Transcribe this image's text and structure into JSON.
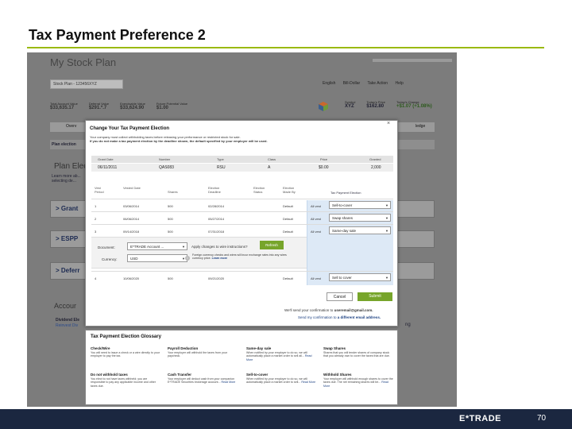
{
  "slide": {
    "title": "Tax Payment Preference 2",
    "footer_logo": "E*TRADE",
    "page_number": "70",
    "accent_color": "#9ab90c",
    "footer_color": "#1b2740"
  },
  "background": {
    "plan_title": "My Stock Plan",
    "plan_select": "Stock Plan - 123456XYZ",
    "top_links": [
      "English",
      "Bill-Dollar",
      "Take Action",
      "Help"
    ],
    "values": [
      {
        "label": "Total Account Value",
        "value": "$33,635.17"
      },
      {
        "label": "Deferral Value",
        "value": "$291.*.7"
      },
      {
        "label": "Exercisable Value",
        "value": "$33,624.90"
      },
      {
        "label": "Future Potential Value",
        "value": "$1.00"
      }
    ],
    "ticker": [
      {
        "label": "Symbol",
        "value": "XYZ"
      },
      {
        "label": "Today's Price",
        "value": "$162.80"
      },
      {
        "label": "Today's Change",
        "value": "+$1.07 (+1.08%)"
      }
    ],
    "tab_left": "Overv",
    "tab_right": "ledge",
    "plan_election_label": "Plan election",
    "section_heading": "Plan Elec",
    "section_desc": "Learn more ab... selecting de...",
    "sections": [
      "Grant",
      "ESPP",
      "Deferr"
    ],
    "account_heading": "Accour",
    "dividend_lines": [
      "Dividend Ele",
      "Reinvest Div"
    ],
    "side_note": "ng"
  },
  "modal": {
    "title": "Change Your Tax Payment Election",
    "desc": "Your company must collect withholding taxes before releasing your performance or restricted stock for sale.",
    "desc_bold": "If you do not make a tax payment election by the deadline shown, the default specified by your employer will be used.",
    "close": "×",
    "grant_headers": [
      "Grant Date",
      "Number",
      "Type",
      "Class",
      "Price",
      "Granted"
    ],
    "grant_row": [
      "06/11/2011",
      "QAS083",
      "RSU",
      "A",
      "$0.00",
      "2,000"
    ],
    "schedule_headers": [
      "Vest Period",
      "Vested Date",
      "Shares",
      "Election Deadline",
      "Election Status",
      "Election Made By",
      "Tax Payment Election"
    ],
    "rows": [
      {
        "period": "1",
        "vest_date": "03/06/2014",
        "shares": "500",
        "deadline": "02/28/2014",
        "made_by": "Default",
        "attrib": "All vest",
        "election": "Sell-to-cover"
      },
      {
        "period": "2",
        "vest_date": "06/06/2014",
        "shares": "500",
        "deadline": "05/27/2014",
        "made_by": "Default",
        "attrib": "All vest",
        "election": "Swap shares"
      },
      {
        "period": "3",
        "vest_date": "09/14/2018",
        "shares": "500",
        "deadline": "07/31/2018",
        "made_by": "Default",
        "attrib": "All vest",
        "election": "Same-day sale"
      },
      {
        "period": "4",
        "vest_date": "10/06/2020",
        "shares": "500",
        "deadline": "09/21/2020",
        "made_by": "Default",
        "attrib": "All vest",
        "election": "Sell to cover"
      }
    ],
    "document_label": "Document:",
    "document_value": "E*TRADE Account ...",
    "currency_label": "Currency:",
    "currency_value": "USD",
    "apply_label": "Apply changes to wire instructions?",
    "refresh": "Refresh",
    "consent_text": "Foreign currency checks and wires will incur exchange rates into any wires currency price.",
    "consent_link": "Learn more",
    "info_icon": "i",
    "cancel": "Cancel",
    "submit": "Submit",
    "confirm_text": "We'll send your confirmation to",
    "confirm_email": "useremail@gmail.com.",
    "alt_text": "Send my confirmation to",
    "alt_link": "a different email address."
  },
  "glossary": {
    "title": "Tax Payment Election Glossary",
    "items": [
      {
        "term": "Check/Wire",
        "desc": "You will need to issue a check or a wire directly to your employer to pay the tax."
      },
      {
        "term": "Payroll Deduction",
        "desc": "Your employer will withhold the taxes from your paycheck."
      },
      {
        "term": "Same-day sale",
        "desc": "When notified by your employer to do so, we will automatically place a market order to sell all...",
        "more": "Read More"
      },
      {
        "term": "Swap Shares",
        "desc": "Shares that you will tender shares of company stock that you already own to cover the taxes that are due."
      },
      {
        "term": "Do not withhold taxes",
        "desc": "You elect to not have taxes withheld; you are responsible to pay any applicable income and other taxes due."
      },
      {
        "term": "Cash Transfer",
        "desc": "Your employer will deduct cash from your companion E*TRADE Securities brokerage account...",
        "more": "Read More"
      },
      {
        "term": "Sell-to-cover",
        "desc": "When notified by your employer to do so, we will automatically place a market order to sell...",
        "more": "Read More"
      },
      {
        "term": "Withhold Shares",
        "desc": "Your employer will withhold enough shares to cover the taxes due. The net remaining shares will be...",
        "more": "Read More"
      }
    ]
  }
}
